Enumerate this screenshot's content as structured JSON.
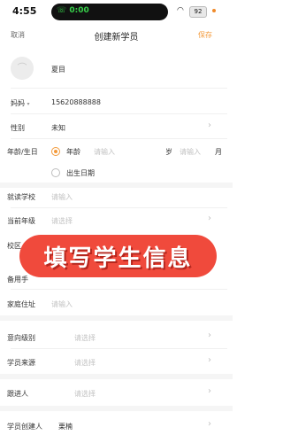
{
  "status_bar": {
    "time": "4:55",
    "call_time": "0:00",
    "battery": "92"
  },
  "nav": {
    "cancel": "取消",
    "title": "创建新学员",
    "save": "保存"
  },
  "student": {
    "name": "夏目",
    "avatar_icon": "avatar-placeholder-icon"
  },
  "contact": {
    "relation": "妈妈",
    "relation_arrow": "▾",
    "phone": "15620888888"
  },
  "gender": {
    "label": "性别",
    "value": "未知"
  },
  "age_birth": {
    "label": "年龄/生日",
    "option_age": "年龄",
    "age_placeholder_1": "请输入",
    "unit_year": "岁",
    "age_placeholder_2": "请输入",
    "unit_month": "月",
    "option_birthday": "出生日期"
  },
  "school": {
    "label": "就读学校",
    "placeholder": "请输入"
  },
  "grade": {
    "label": "当前年级",
    "placeholder": "请选择"
  },
  "campus": {
    "label": "校区"
  },
  "backup_phone": {
    "label": "备用手"
  },
  "address": {
    "label": "家庭住址",
    "placeholder": "请输入"
  },
  "intent_level": {
    "label": "意向级别",
    "placeholder": "请选择"
  },
  "source": {
    "label": "学员来源",
    "placeholder": "请选择"
  },
  "follower": {
    "label": "跟进人",
    "placeholder": "请选择"
  },
  "creator": {
    "label": "学员创建人",
    "value": "栗楠"
  },
  "overlay": {
    "text": "填写学生信息"
  },
  "chevron": "›",
  "colors": {
    "accent": "#f39a3b",
    "overlay": "#f04a3c",
    "call_green": "#37d14a"
  }
}
